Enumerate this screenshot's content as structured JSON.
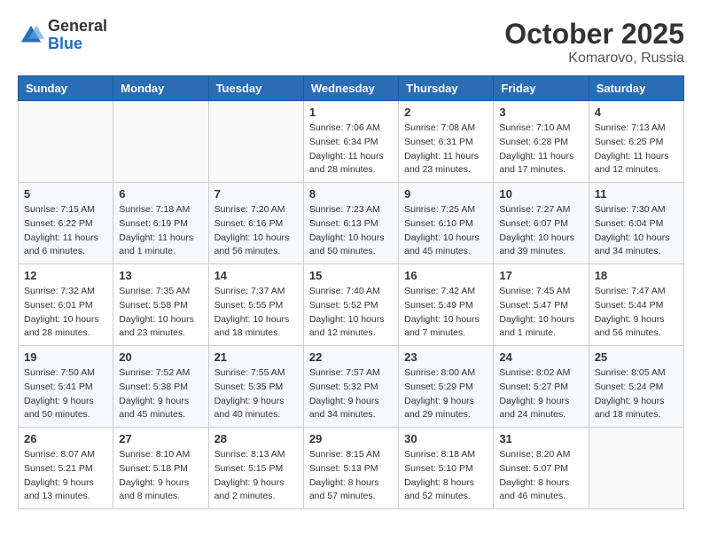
{
  "header": {
    "logo_general": "General",
    "logo_blue": "Blue",
    "month_title": "October 2025",
    "location": "Komarovo, Russia"
  },
  "days_of_week": [
    "Sunday",
    "Monday",
    "Tuesday",
    "Wednesday",
    "Thursday",
    "Friday",
    "Saturday"
  ],
  "weeks": [
    [
      {
        "day": "",
        "info": ""
      },
      {
        "day": "",
        "info": ""
      },
      {
        "day": "",
        "info": ""
      },
      {
        "day": "1",
        "info": "Sunrise: 7:06 AM\nSunset: 6:34 PM\nDaylight: 11 hours\nand 28 minutes."
      },
      {
        "day": "2",
        "info": "Sunrise: 7:08 AM\nSunset: 6:31 PM\nDaylight: 11 hours\nand 23 minutes."
      },
      {
        "day": "3",
        "info": "Sunrise: 7:10 AM\nSunset: 6:28 PM\nDaylight: 11 hours\nand 17 minutes."
      },
      {
        "day": "4",
        "info": "Sunrise: 7:13 AM\nSunset: 6:25 PM\nDaylight: 11 hours\nand 12 minutes."
      }
    ],
    [
      {
        "day": "5",
        "info": "Sunrise: 7:15 AM\nSunset: 6:22 PM\nDaylight: 11 hours\nand 6 minutes."
      },
      {
        "day": "6",
        "info": "Sunrise: 7:18 AM\nSunset: 6:19 PM\nDaylight: 11 hours\nand 1 minute."
      },
      {
        "day": "7",
        "info": "Sunrise: 7:20 AM\nSunset: 6:16 PM\nDaylight: 10 hours\nand 56 minutes."
      },
      {
        "day": "8",
        "info": "Sunrise: 7:23 AM\nSunset: 6:13 PM\nDaylight: 10 hours\nand 50 minutes."
      },
      {
        "day": "9",
        "info": "Sunrise: 7:25 AM\nSunset: 6:10 PM\nDaylight: 10 hours\nand 45 minutes."
      },
      {
        "day": "10",
        "info": "Sunrise: 7:27 AM\nSunset: 6:07 PM\nDaylight: 10 hours\nand 39 minutes."
      },
      {
        "day": "11",
        "info": "Sunrise: 7:30 AM\nSunset: 6:04 PM\nDaylight: 10 hours\nand 34 minutes."
      }
    ],
    [
      {
        "day": "12",
        "info": "Sunrise: 7:32 AM\nSunset: 6:01 PM\nDaylight: 10 hours\nand 28 minutes."
      },
      {
        "day": "13",
        "info": "Sunrise: 7:35 AM\nSunset: 5:58 PM\nDaylight: 10 hours\nand 23 minutes."
      },
      {
        "day": "14",
        "info": "Sunrise: 7:37 AM\nSunset: 5:55 PM\nDaylight: 10 hours\nand 18 minutes."
      },
      {
        "day": "15",
        "info": "Sunrise: 7:40 AM\nSunset: 5:52 PM\nDaylight: 10 hours\nand 12 minutes."
      },
      {
        "day": "16",
        "info": "Sunrise: 7:42 AM\nSunset: 5:49 PM\nDaylight: 10 hours\nand 7 minutes."
      },
      {
        "day": "17",
        "info": "Sunrise: 7:45 AM\nSunset: 5:47 PM\nDaylight: 10 hours\nand 1 minute."
      },
      {
        "day": "18",
        "info": "Sunrise: 7:47 AM\nSunset: 5:44 PM\nDaylight: 9 hours\nand 56 minutes."
      }
    ],
    [
      {
        "day": "19",
        "info": "Sunrise: 7:50 AM\nSunset: 5:41 PM\nDaylight: 9 hours\nand 50 minutes."
      },
      {
        "day": "20",
        "info": "Sunrise: 7:52 AM\nSunset: 5:38 PM\nDaylight: 9 hours\nand 45 minutes."
      },
      {
        "day": "21",
        "info": "Sunrise: 7:55 AM\nSunset: 5:35 PM\nDaylight: 9 hours\nand 40 minutes."
      },
      {
        "day": "22",
        "info": "Sunrise: 7:57 AM\nSunset: 5:32 PM\nDaylight: 9 hours\nand 34 minutes."
      },
      {
        "day": "23",
        "info": "Sunrise: 8:00 AM\nSunset: 5:29 PM\nDaylight: 9 hours\nand 29 minutes."
      },
      {
        "day": "24",
        "info": "Sunrise: 8:02 AM\nSunset: 5:27 PM\nDaylight: 9 hours\nand 24 minutes."
      },
      {
        "day": "25",
        "info": "Sunrise: 8:05 AM\nSunset: 5:24 PM\nDaylight: 9 hours\nand 18 minutes."
      }
    ],
    [
      {
        "day": "26",
        "info": "Sunrise: 8:07 AM\nSunset: 5:21 PM\nDaylight: 9 hours\nand 13 minutes."
      },
      {
        "day": "27",
        "info": "Sunrise: 8:10 AM\nSunset: 5:18 PM\nDaylight: 9 hours\nand 8 minutes."
      },
      {
        "day": "28",
        "info": "Sunrise: 8:13 AM\nSunset: 5:15 PM\nDaylight: 9 hours\nand 2 minutes."
      },
      {
        "day": "29",
        "info": "Sunrise: 8:15 AM\nSunset: 5:13 PM\nDaylight: 8 hours\nand 57 minutes."
      },
      {
        "day": "30",
        "info": "Sunrise: 8:18 AM\nSunset: 5:10 PM\nDaylight: 8 hours\nand 52 minutes."
      },
      {
        "day": "31",
        "info": "Sunrise: 8:20 AM\nSunset: 5:07 PM\nDaylight: 8 hours\nand 46 minutes."
      },
      {
        "day": "",
        "info": ""
      }
    ]
  ]
}
